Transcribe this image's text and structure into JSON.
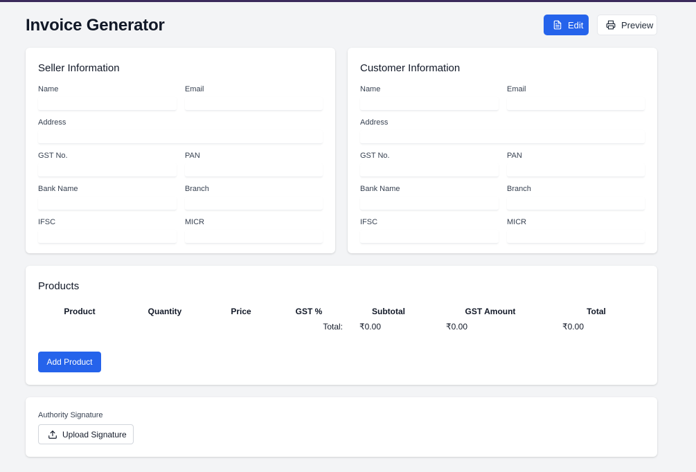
{
  "app": {
    "title": "Invoice Generator",
    "accent_color": "#2563eb",
    "top_bar_color": "#3b2a5c"
  },
  "header": {
    "edit_label": "Edit",
    "edit_icon": "document-icon",
    "preview_label": "Preview",
    "preview_icon": "printer-icon"
  },
  "seller": {
    "title": "Seller Information",
    "fields": {
      "name": {
        "label": "Name",
        "value": ""
      },
      "email": {
        "label": "Email",
        "value": ""
      },
      "address": {
        "label": "Address",
        "value": ""
      },
      "gst": {
        "label": "GST No.",
        "value": ""
      },
      "pan": {
        "label": "PAN",
        "value": ""
      },
      "bank_name": {
        "label": "Bank Name",
        "value": ""
      },
      "branch": {
        "label": "Branch",
        "value": ""
      },
      "ifsc": {
        "label": "IFSC",
        "value": ""
      },
      "micr": {
        "label": "MICR",
        "value": ""
      }
    }
  },
  "customer": {
    "title": "Customer Information",
    "fields": {
      "name": {
        "label": "Name",
        "value": ""
      },
      "email": {
        "label": "Email",
        "value": ""
      },
      "address": {
        "label": "Address",
        "value": ""
      },
      "gst": {
        "label": "GST No.",
        "value": ""
      },
      "pan": {
        "label": "PAN",
        "value": ""
      },
      "bank_name": {
        "label": "Bank Name",
        "value": ""
      },
      "branch": {
        "label": "Branch",
        "value": ""
      },
      "ifsc": {
        "label": "IFSC",
        "value": ""
      },
      "micr": {
        "label": "MICR",
        "value": ""
      }
    }
  },
  "products": {
    "title": "Products",
    "columns": [
      "Product",
      "Quantity",
      "Price",
      "GST %",
      "Subtotal",
      "GST Amount",
      "Total"
    ],
    "rows": [],
    "totals": {
      "label": "Total:",
      "subtotal": "₹0.00",
      "gst_amount": "₹0.00",
      "total": "₹0.00"
    },
    "add_label": "Add Product"
  },
  "signature": {
    "label": "Authority Signature",
    "upload_label": "Upload Signature",
    "upload_icon": "upload-icon"
  }
}
